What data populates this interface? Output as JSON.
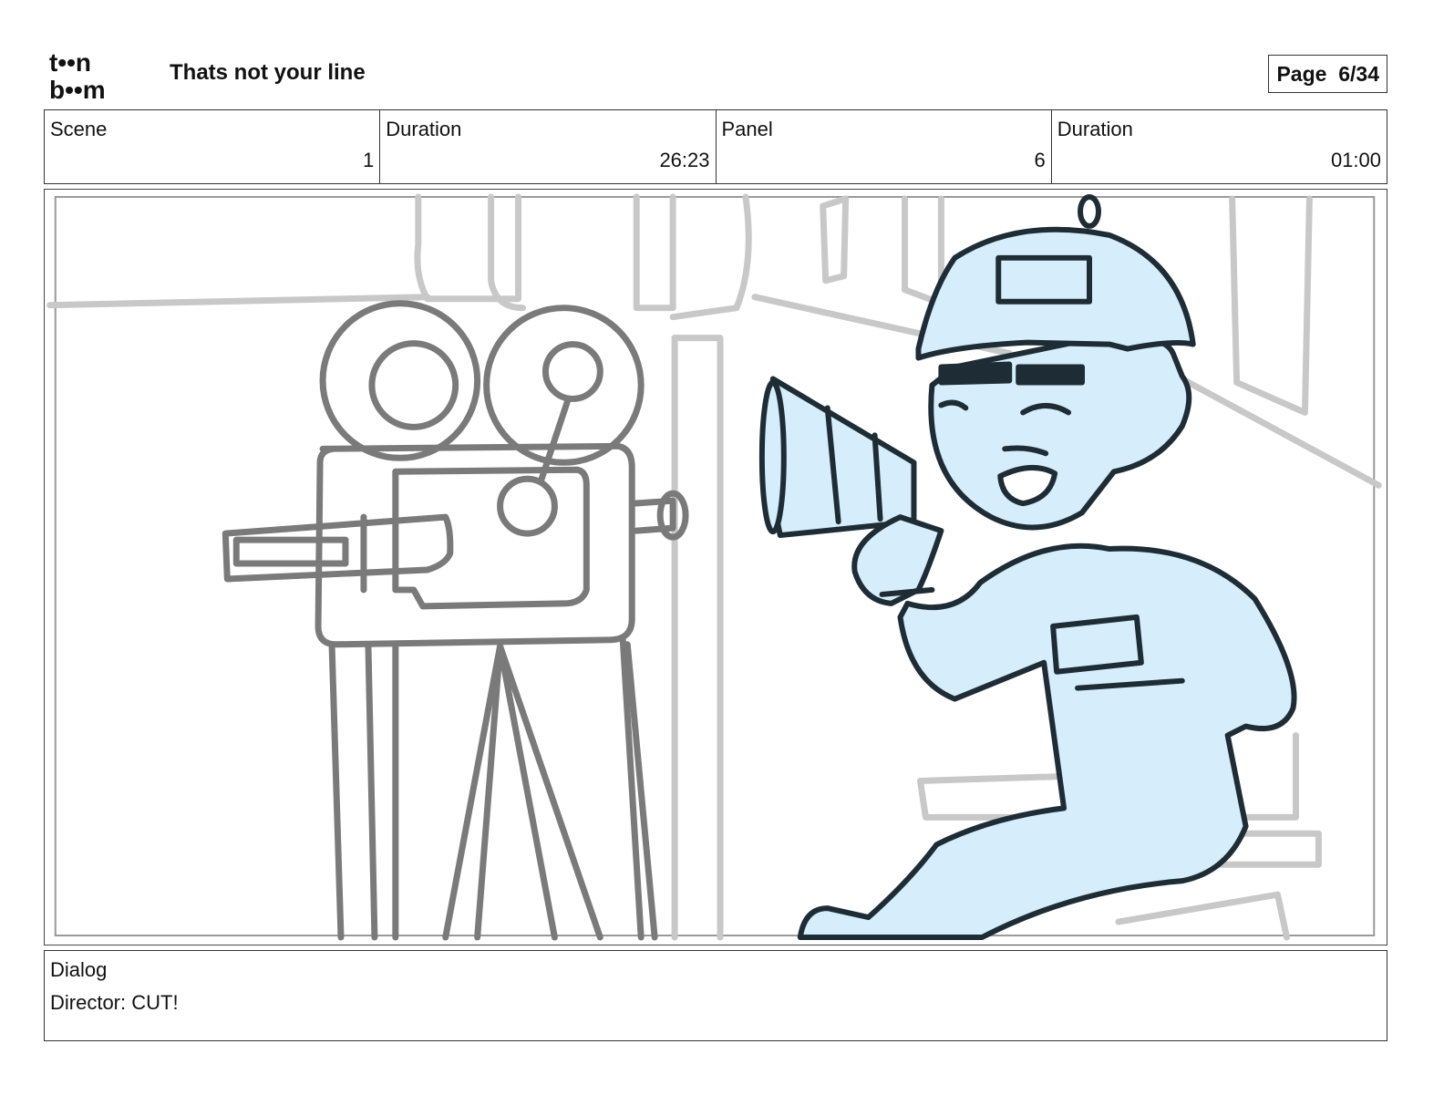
{
  "header": {
    "logo_top": "t••n",
    "logo_bottom": "b••m",
    "title": "Thats not your line",
    "page_label": "Page",
    "page_value": "6/34"
  },
  "meta": {
    "scene_label": "Scene",
    "scene_value": "1",
    "scene_duration_label": "Duration",
    "scene_duration_value": "26:23",
    "panel_label": "Panel",
    "panel_value": "6",
    "panel_duration_label": "Duration",
    "panel_duration_value": "01:00"
  },
  "dialog": {
    "label": "Dialog",
    "text": "Director: CUT!"
  },
  "colors": {
    "sketch_gray": "#7a7a7a",
    "light_gray": "#c8c8c8",
    "character_fill": "#d6eefb",
    "character_line": "#1e2d35"
  },
  "icons": {
    "logo": "toonboom-logo-icon",
    "camera": "film-camera-icon",
    "character": "director-with-megaphone-icon"
  }
}
